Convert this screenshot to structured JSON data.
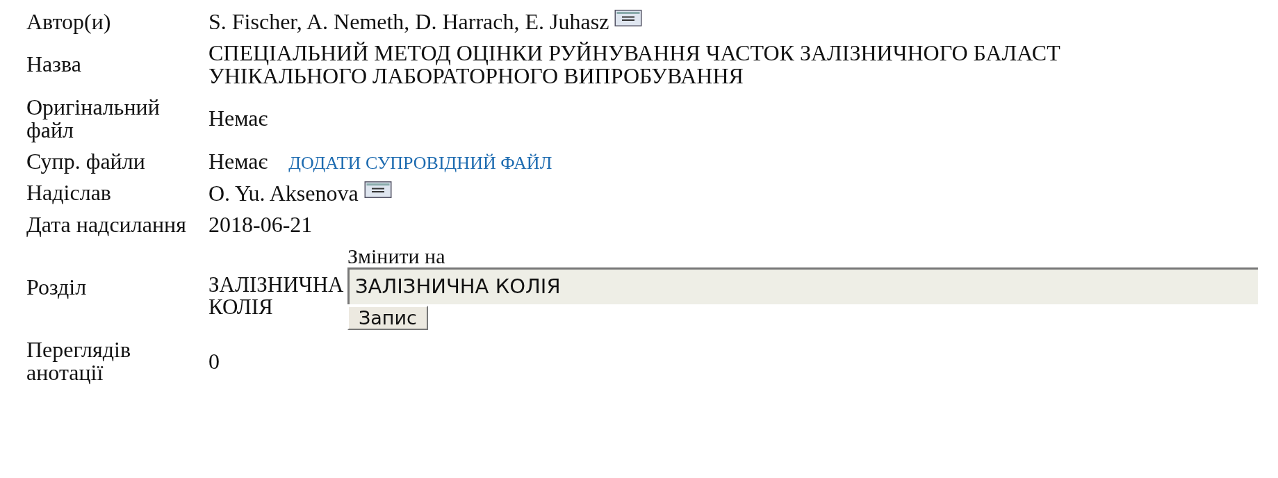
{
  "rows": [
    {
      "label": "Автор(и)",
      "kind": "text",
      "value": "S. Fischer, A. Nemeth, D. Harrach, E. Juhasz",
      "email_icon": true
    },
    {
      "label": "Назва",
      "kind": "lines",
      "lines": [
        "СПЕЦІАЛЬНИЙ МЕТОД ОЦІНКИ РУЙНУВАННЯ ЧАСТОК ЗАЛІЗНИЧНОГО БАЛАСТ",
        "УНІКАЛЬНОГО ЛАБОРАТОРНОГО ВИПРОБУВАННЯ"
      ]
    },
    {
      "label": "Оригінальний файл",
      "kind": "text",
      "value": "Немає"
    },
    {
      "label": "Супр. файли",
      "kind": "text",
      "value": "Немає",
      "link": "ДОДАТИ СУПРОВІДНИЙ ФАЙЛ"
    },
    {
      "label": "Надіслав",
      "kind": "text",
      "value": "O. Yu. Aksenova",
      "email_icon": true
    },
    {
      "label": "Дата надсилання",
      "kind": "text",
      "value": "2018-06-21"
    },
    {
      "label": "Розділ",
      "kind": "section",
      "value": "ЗАЛІЗНИЧНА КОЛІЯ",
      "change_label": "Змінити на",
      "select_value": "ЗАЛІЗНИЧНА КОЛІЯ",
      "button": "Запис"
    },
    {
      "label": "Переглядів анотації",
      "kind": "text",
      "value": "0"
    }
  ]
}
